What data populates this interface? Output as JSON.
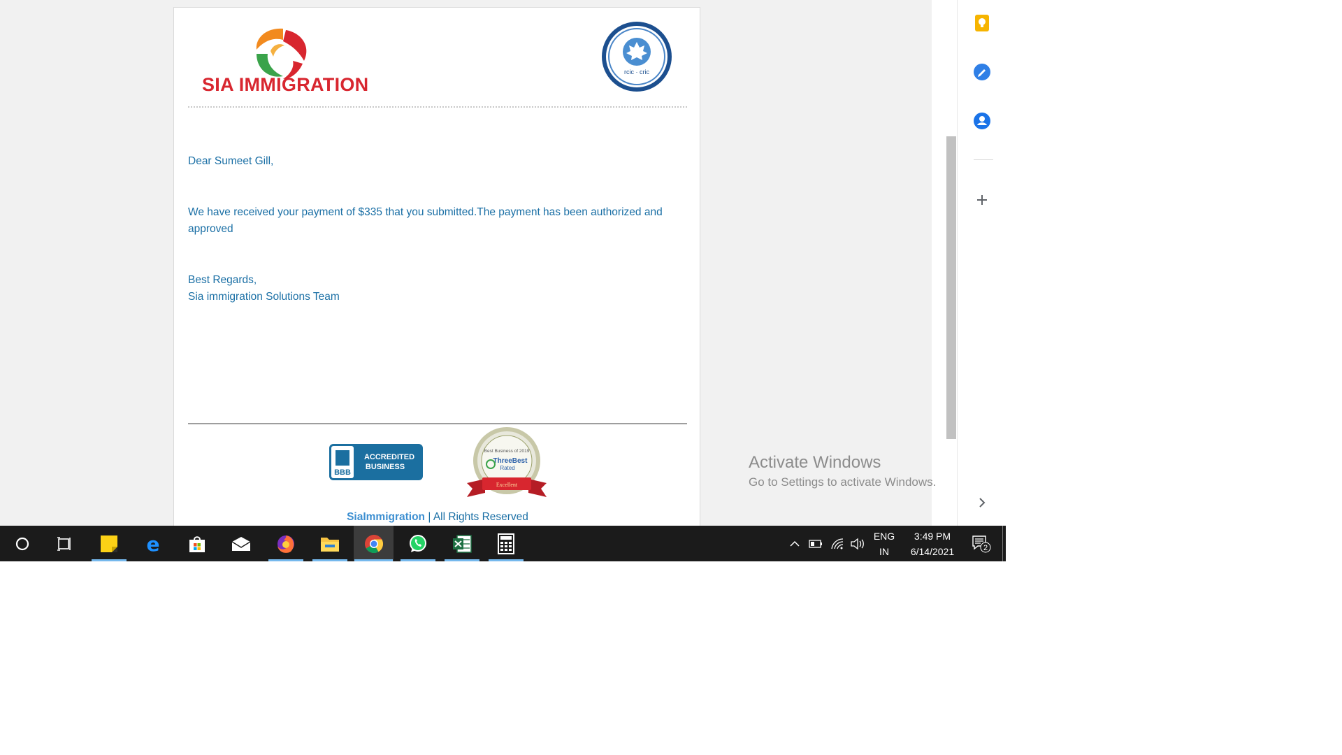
{
  "email": {
    "brand_name": "SIA IMMIGRATION",
    "seal_text": "rcic · cric",
    "greeting": "Dear Sumeet Gill,",
    "message": "We have received your payment of $335 that you submitted.The payment has been authorized and approved",
    "regards": "Best Regards,",
    "team": "Sia immigration Solutions Team",
    "bbb_badge": {
      "top": "ACCREDITED",
      "bottom": "BUSINESS",
      "mark": "BBB"
    },
    "award_badge": {
      "line1": "Best Business of 2019",
      "line2": "ThreeBest",
      "line3": "Rated",
      "ribbon": "Excellent"
    },
    "footer_brand": "SiaImmigration",
    "footer_rest": " | All Rights Reserved"
  },
  "side_panel": {
    "icons": [
      "keep-icon",
      "tasks-icon",
      "contacts-icon",
      "add-icon",
      "chevron-right-icon"
    ]
  },
  "watermark": {
    "title": "Activate Windows",
    "subtitle": "Go to Settings to activate Windows."
  },
  "taskbar": {
    "apps": [
      "cortana-icon",
      "task-view-icon",
      "sticky-notes-icon",
      "edge-icon",
      "store-icon",
      "mail-icon",
      "firefox-icon",
      "file-explorer-icon",
      "chrome-icon",
      "whatsapp-icon",
      "excel-icon",
      "calculator-icon"
    ],
    "language_top": "ENG",
    "language_bottom": "IN",
    "time": "3:49 PM",
    "date": "6/14/2021",
    "notification_count": "2"
  },
  "colors": {
    "brand_red": "#d8262f",
    "email_text": "#1a6fa5",
    "footer_brand": "#3d8fd1",
    "taskbar_bg": "#1b1b1b",
    "taskbar_accent": "#76b9ed"
  }
}
